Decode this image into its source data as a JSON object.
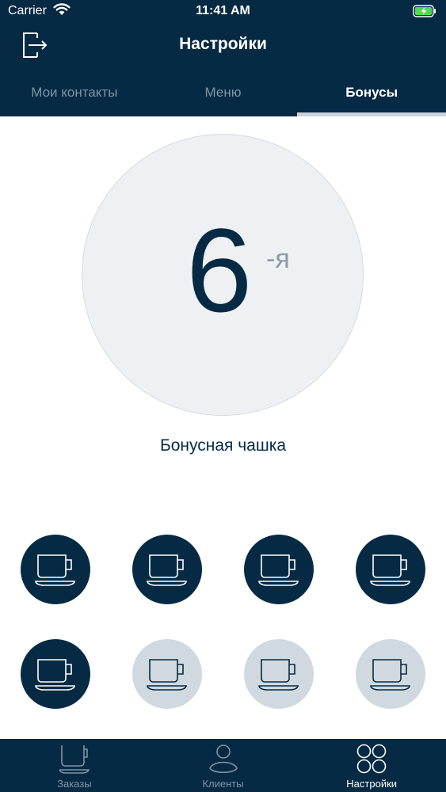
{
  "status_bar": {
    "carrier": "Carrier",
    "time": "11:41 AM"
  },
  "header": {
    "title": "Настройки"
  },
  "tabs": [
    {
      "label": "Мои контакты",
      "active": false
    },
    {
      "label": "Меню",
      "active": false
    },
    {
      "label": "Бонусы",
      "active": true
    }
  ],
  "bonus": {
    "number": "6",
    "suffix": "-я",
    "label": "Бонусная чашка"
  },
  "cups": {
    "total": 8,
    "filled": 5
  },
  "tabbar": [
    {
      "label": "Заказы",
      "icon": "cup-icon",
      "active": false
    },
    {
      "label": "Клиенты",
      "icon": "person-icon",
      "active": false
    },
    {
      "label": "Настройки",
      "icon": "grid-circles-icon",
      "active": true
    }
  ],
  "colors": {
    "primary": "#062a44",
    "circle_bg": "#eef0f3",
    "cup_empty": "#d0d9df",
    "inactive_text": "#7f94a6",
    "suffix": "#8d9aa5"
  }
}
